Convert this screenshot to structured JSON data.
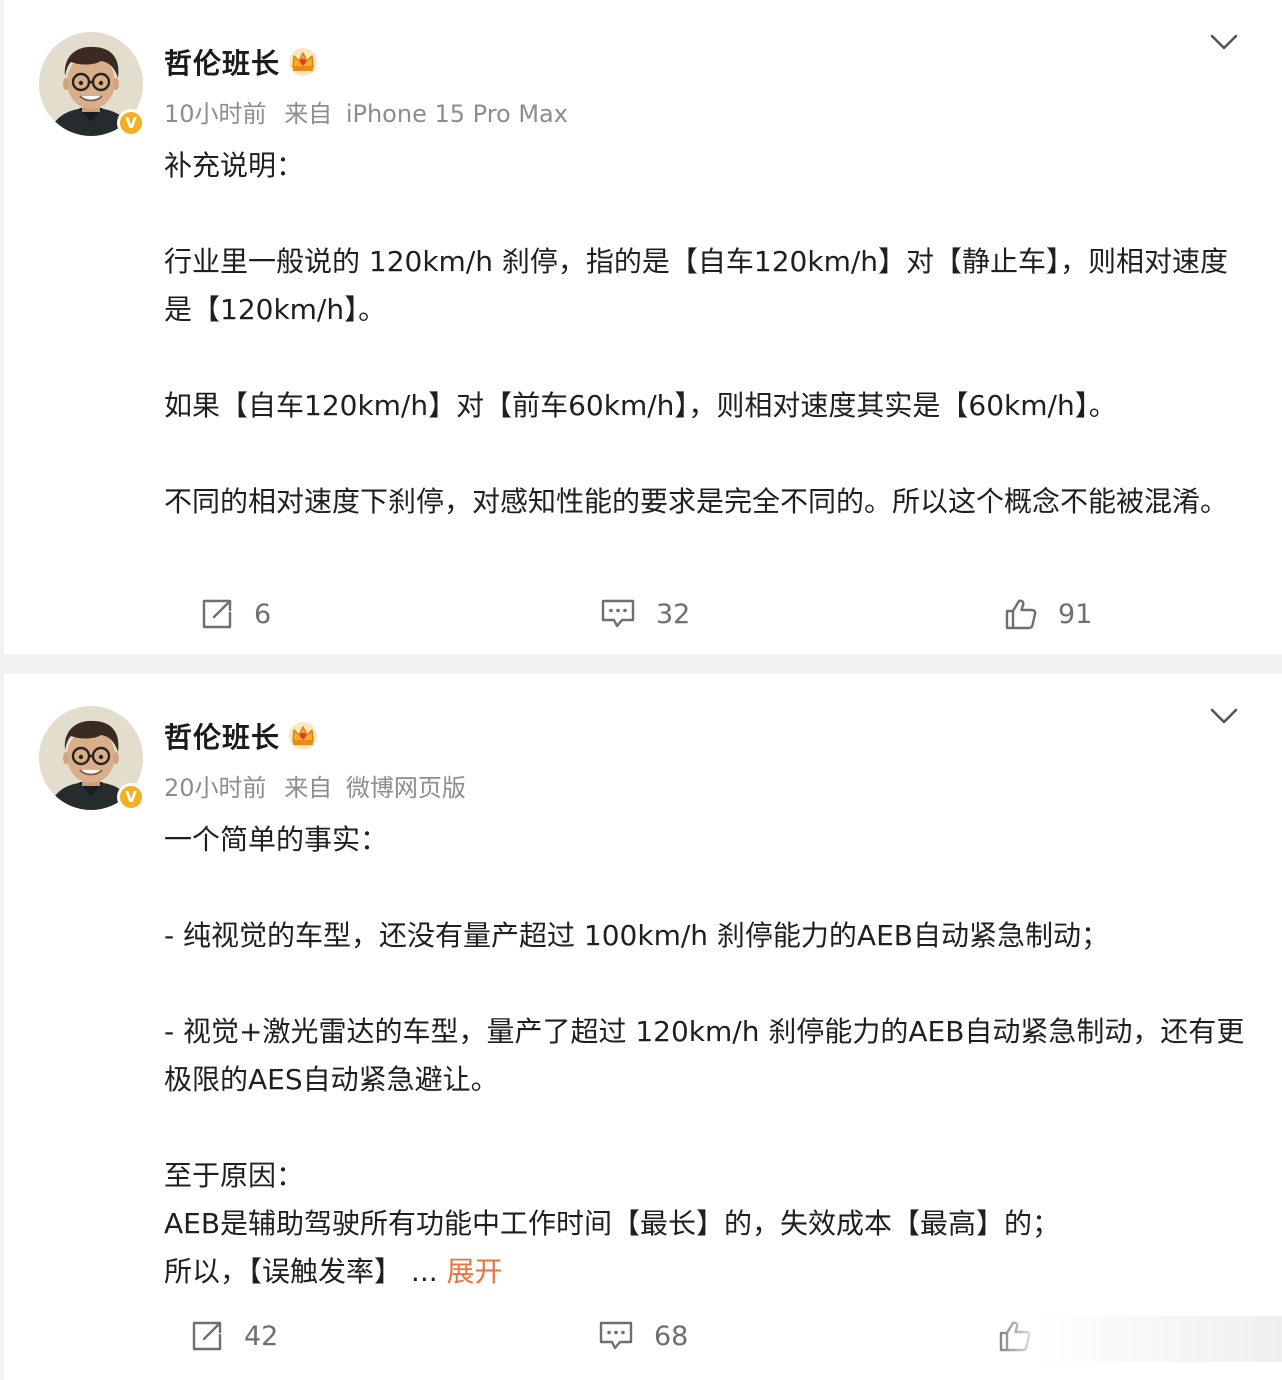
{
  "colors": {
    "page_bg": "#f1f1f3",
    "card_bg": "#ffffff",
    "meta_gray": "#8d8d8d",
    "action_gray": "#6f6f6f",
    "expand_orange": "#eb7340",
    "verified_gold": "#f3b022"
  },
  "posts": [
    {
      "author": "哲伦班长",
      "author_badge_icon": "crown-icon",
      "verified_icon": "verified-v-icon",
      "time": "10小时前",
      "source_prefix": "来自",
      "source": "iPhone 15 Pro Max",
      "menu_icon": "chevron-down-icon",
      "paragraphs": [
        "补充说明：",
        "行业里一般说的 120km/h 刹停，指的是【自车120km/h】对【静止车】，则相对速度是【120km/h】。",
        "如果【自车120km/h】对【前车60km/h】，则相对速度其实是【60km/h】。",
        "不同的相对速度下刹停，对感知性能的要求是完全不同的。所以这个概念不能被混淆。"
      ],
      "reposts": "6",
      "comments": "32",
      "likes": "91"
    },
    {
      "author": "哲伦班长",
      "author_badge_icon": "crown-icon",
      "verified_icon": "verified-v-icon",
      "time": "20小时前",
      "source_prefix": "来自",
      "source": "微博网页版",
      "menu_icon": "chevron-down-icon",
      "paragraphs": [
        "一个简单的事实：",
        "- 纯视觉的车型，还没有量产超过 100km/h 刹停能力的AEB自动紧急制动；",
        "- 视觉+激光雷达的车型，量产了超过 120km/h 刹停能力的AEB自动紧急制动，还有更极限的AES自动紧急避让。",
        "至于原因：",
        "AEB是辅助驾驶所有功能中工作时间【最长】的，失效成本【最高】的；",
        "所以，【误触发率】"
      ],
      "truncation": " ... ",
      "expand_label": "展开",
      "reposts": "42",
      "comments": "68"
    }
  ]
}
